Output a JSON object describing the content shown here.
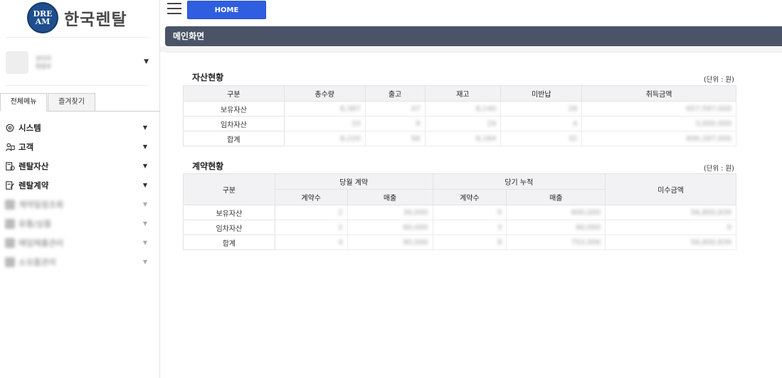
{
  "brand": {
    "logo_mark": "DRE AM",
    "name": "한국렌탈"
  },
  "user": {
    "name": "관리자",
    "role": "영업부"
  },
  "sidebar": {
    "tabs": [
      {
        "label": "전체메뉴"
      },
      {
        "label": "즐겨찾기"
      }
    ],
    "items": [
      {
        "label": "시스템",
        "icon": "gear-icon"
      },
      {
        "label": "고객",
        "icon": "customer-icon"
      },
      {
        "label": "렌탈자산",
        "icon": "asset-icon"
      },
      {
        "label": "렌탈계약",
        "icon": "contract-icon"
      },
      {
        "label": "계약일정조회",
        "icon": "schedule-icon"
      },
      {
        "label": "유통/상품",
        "icon": "product-icon"
      },
      {
        "label": "매입매출관리",
        "icon": "sales-icon"
      },
      {
        "label": "소모품관리",
        "icon": "supplies-icon"
      }
    ]
  },
  "header": {
    "home_label": "HOME",
    "page_title": "메인화면"
  },
  "asset_status": {
    "title": "자산현황",
    "unit": "(단위 : 원)",
    "columns": [
      "구분",
      "총수량",
      "출고",
      "재고",
      "미반납",
      "취득금액"
    ],
    "rows": [
      {
        "label": "보유자산",
        "values": [
          "8,387",
          "47",
          "8,140",
          "28",
          "657,597,000"
        ]
      },
      {
        "label": "임차자산",
        "values": [
          "33",
          "9",
          "24",
          "4",
          "3,000,000"
        ]
      },
      {
        "label": "합계",
        "values": [
          "8,220",
          "56",
          "8,164",
          "32",
          "606,287,000"
        ]
      }
    ]
  },
  "contract_status": {
    "title": "계약현황",
    "unit": "(단위 : 원)",
    "header_group": {
      "category": "구분",
      "current": "당월 계약",
      "cumulative": "당기 누적",
      "receivable": "미수금액"
    },
    "sub_columns": [
      "계약수",
      "매출",
      "계약수",
      "매출"
    ],
    "rows": [
      {
        "label": "보유자산",
        "values": [
          "2",
          "30,000",
          "5",
          "600,000",
          "56,800,839"
        ]
      },
      {
        "label": "임차자산",
        "values": [
          "2",
          "60,000",
          "3",
          "60,000",
          "0"
        ]
      },
      {
        "label": "합계",
        "values": [
          "4",
          "90,000",
          "8",
          "753,000",
          "56,800,839"
        ]
      }
    ]
  },
  "colors": {
    "home_button": "#2f5fe0",
    "title_bar": "#4a5466",
    "table_header": "#f2f2f4"
  }
}
